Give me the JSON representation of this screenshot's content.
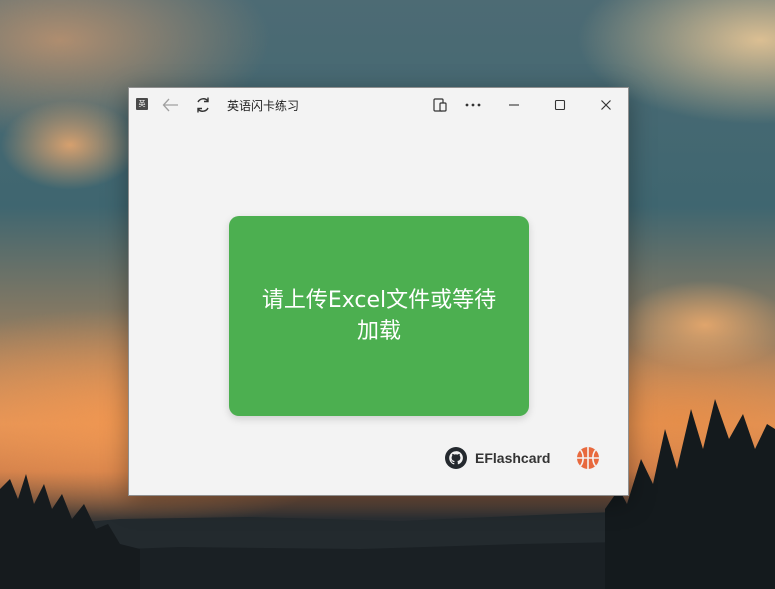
{
  "window": {
    "title": "英语闪卡练习",
    "app_icon_glyph": "英"
  },
  "main": {
    "upload_message": "请上传Excel文件或等待加载"
  },
  "footer": {
    "brand": "EFlashcard"
  },
  "icons": {
    "app": "app-icon",
    "back": "arrow-left-icon",
    "reload": "refresh-icon",
    "extension": "extension-icon",
    "more": "more-icon",
    "minimize": "minimize-icon",
    "maximize": "maximize-icon",
    "close": "close-icon",
    "github": "github-icon",
    "ball": "basketball-icon"
  },
  "colors": {
    "card": "#4caf50",
    "accent_ball": "#e8693d"
  }
}
